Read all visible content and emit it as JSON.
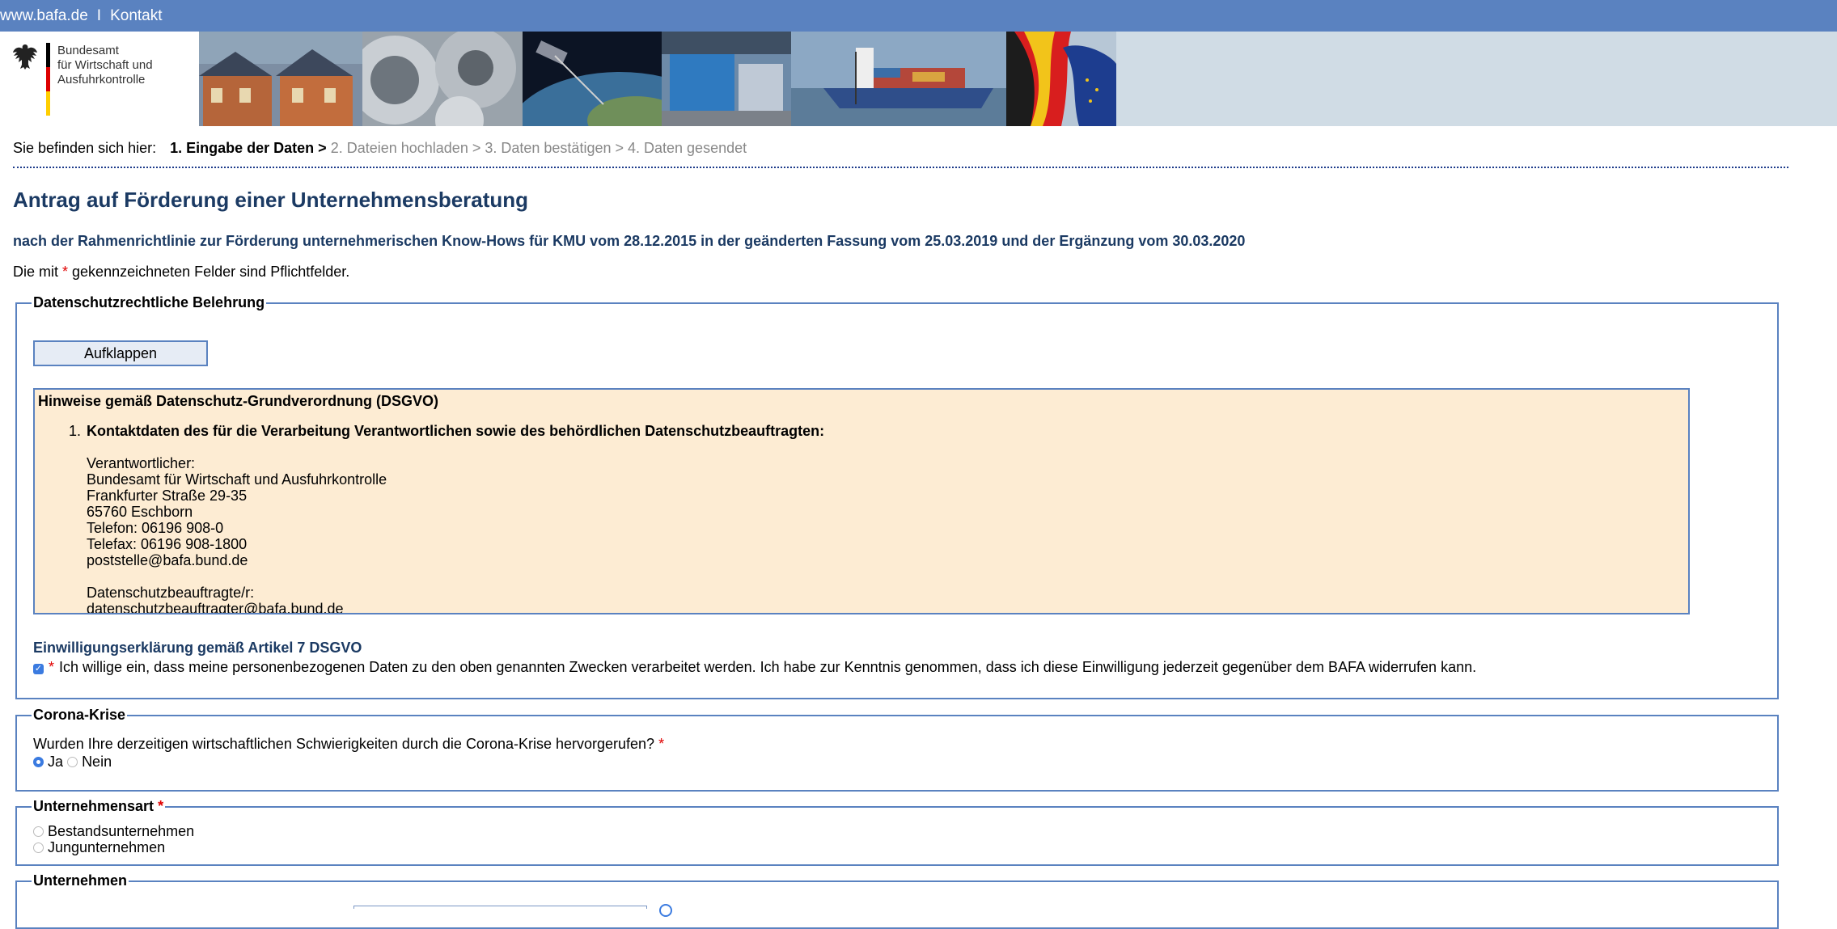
{
  "topbar": {
    "site_link": "www.bafa.de",
    "separator": "I",
    "contact_link": "Kontakt"
  },
  "header": {
    "logo_lines": [
      "Bundesamt",
      "für Wirtschaft und",
      "Ausfuhrkontrolle"
    ],
    "photos": [
      "houses-solar-photo",
      "steel-coils-photo",
      "satellite-earth-photo",
      "trade-fair-photo",
      "container-ship-photo",
      "german-eu-flag-photo"
    ]
  },
  "breadcrumb": {
    "prefix": "Sie befinden sich hier:",
    "current": "1. Eingabe der Daten >",
    "steps": [
      "2. Dateien hochladen",
      " > ",
      "3. Daten bestätigen",
      " > ",
      "4. Daten gesendet"
    ]
  },
  "page": {
    "title": "Antrag auf Förderung einer Unternehmensberatung",
    "subtitle": "nach der Rahmenrichtlinie zur Förderung unternehmerischen Know-Hows für KMU vom 28.12.2015 in der geänderten Fassung vom 25.03.2019 und der Ergänzung vom 30.03.2020",
    "required_note_prefix": "Die mit ",
    "required_marker": "*",
    "required_note_suffix": " gekennzeichneten Felder sind Pflichtfelder."
  },
  "datenschutz": {
    "legend": "Datenschutzrechtliche Belehrung",
    "expand_button": "Aufklappen",
    "box_title": "Hinweise gemäß Datenschutz-Grundverordnung (DSGVO)",
    "item_number": "1.",
    "item_heading": "Kontaktdaten des für die Verarbeitung Verantwortlichen sowie des behördlichen Datenschutzbeauftragten:",
    "address_lines": [
      "Verantwortlicher:",
      "Bundesamt für Wirtschaft und Ausfuhrkontrolle",
      "Frankfurter Straße 29-35",
      "65760 Eschborn",
      "Telefon: 06196 908-0",
      "Telefax: 06196 908-1800",
      "poststelle@bafa.bund.de",
      "",
      "Datenschutzbeauftragte/r:",
      "datenschutzbeauftragter@bafa.bund.de"
    ],
    "consent_title": "Einwilligungserklärung gemäß Artikel 7 DSGVO",
    "consent_checked": true,
    "consent_text": "Ich willige ein, dass meine personenbezogenen Daten zu den oben genannten Zwecken verarbeitet werden. Ich habe zur Kenntnis genommen, dass ich diese Einwilligung jederzeit gegenüber dem BAFA widerrufen kann."
  },
  "corona": {
    "legend": "Corona-Krise",
    "question": "Wurden Ihre derzeitigen wirtschaftlichen Schwierigkeiten durch die Corona-Krise hervorgerufen?",
    "options": [
      "Ja",
      "Nein"
    ],
    "selected": "Ja"
  },
  "unternehmensart": {
    "legend": "Unternehmensart",
    "options": [
      "Bestandsunternehmen",
      "Jungunternehmen"
    ],
    "selected": null
  },
  "unternehmen": {
    "legend": "Unternehmen"
  },
  "colors": {
    "topbar": "#5a82c0",
    "title": "#1b3a63",
    "required": "#e00000",
    "dsgvo_box": "#fdecd3"
  }
}
